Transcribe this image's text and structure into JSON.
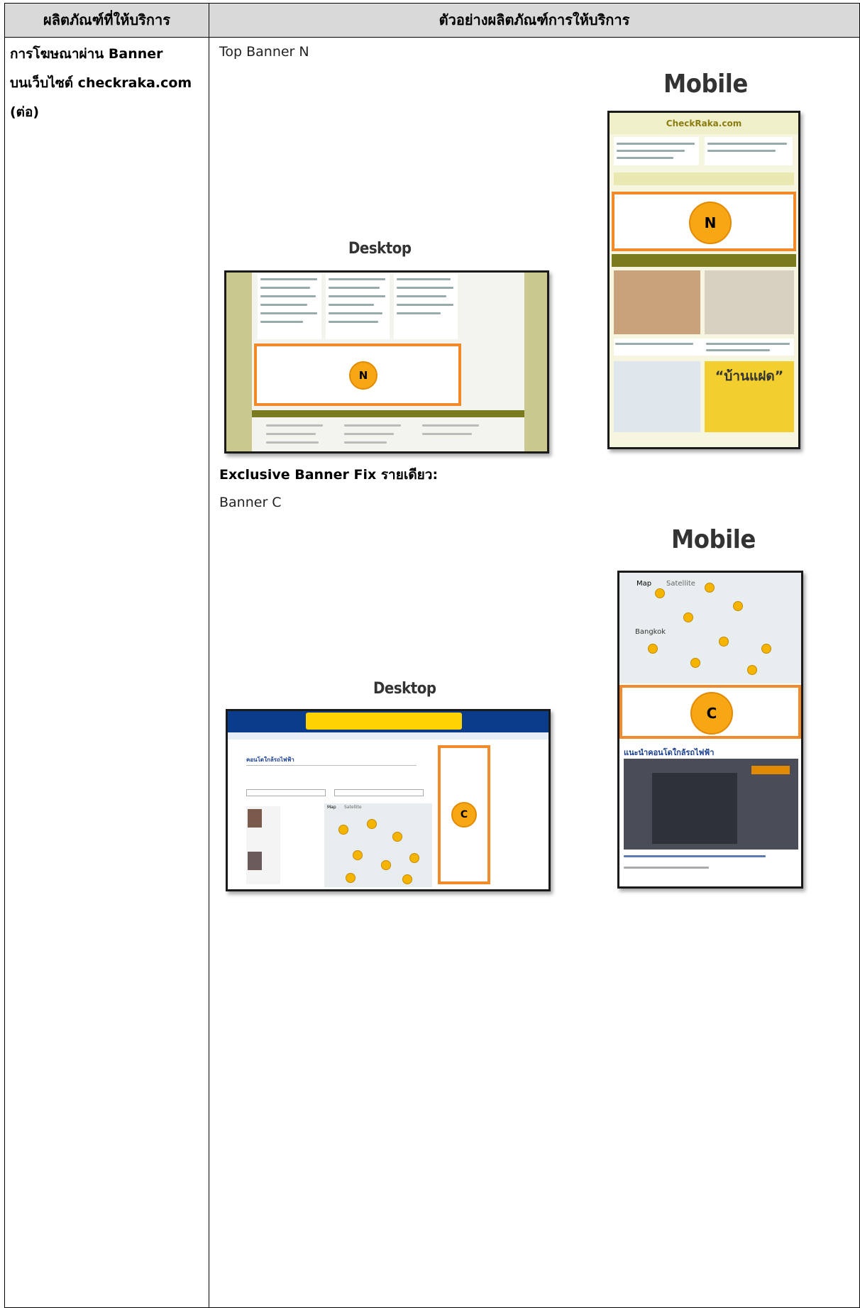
{
  "header": {
    "col_left": "ผลิตภัณฑ์ที่ให้บริการ",
    "col_right": "ตัวอย่างผลิตภัณฑ์การให้บริการ"
  },
  "left_column": {
    "line1": "การโฆษณาผ่าน Banner",
    "line2": "บนเว็บไซต์ checkraka.com",
    "line3": "(ต่อ)"
  },
  "section_top": {
    "title": "Top Banner N",
    "desktop_caption": "Desktop",
    "mobile_caption": "Mobile",
    "badge_letter": "N",
    "mobile_logo": "CheckRaka.com",
    "mobile_house_label": "“บ้านแฝด”"
  },
  "section_c": {
    "exclusive_label": "Exclusive Banner Fix รายเดียว:",
    "title": "Banner C",
    "desktop_caption": "Desktop",
    "mobile_caption": "Mobile",
    "badge_letter": "C",
    "desktop_page_title": "คอนโดใกล้รถไฟฟ้า",
    "mobile_section_title": "แนะนำคอนโดใกล้รถไฟฟ้า",
    "map_tab": "Map",
    "satellite_tab": "Satellite",
    "map_city": "Bangkok"
  },
  "colors": {
    "header_bg": "#d9d9d9",
    "highlight_orange": "#f08a2a",
    "badge_yellow": "#f7a713",
    "olive_bar": "#8a8a2a",
    "page_olive": "#c9c98f"
  }
}
